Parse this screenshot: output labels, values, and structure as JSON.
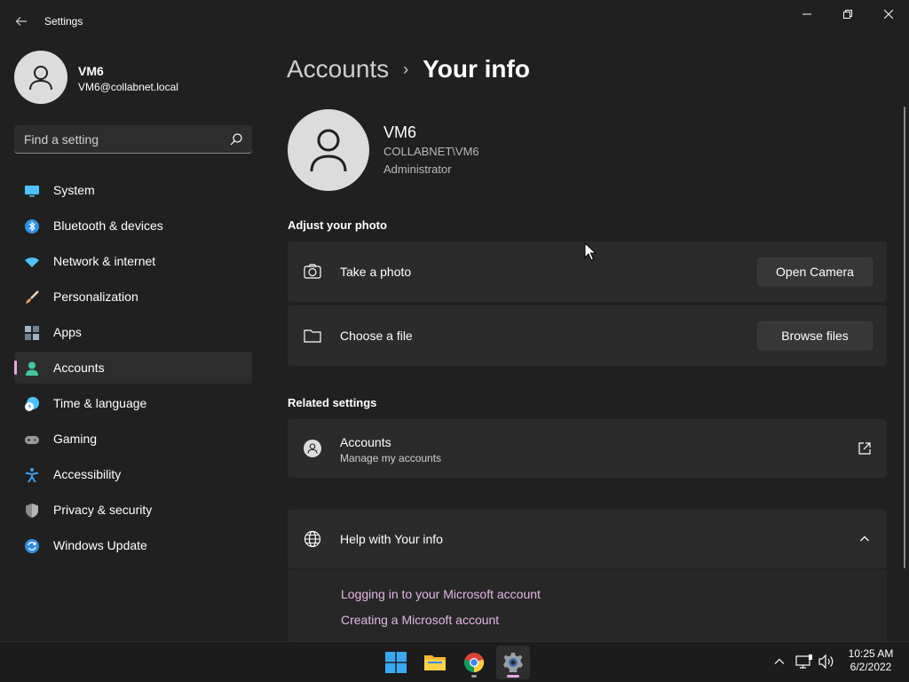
{
  "window": {
    "title": "Settings"
  },
  "profile": {
    "name": "VM6",
    "email": "VM6@collabnet.local"
  },
  "search": {
    "placeholder": "Find a setting"
  },
  "sidebar": {
    "items": [
      {
        "label": "System",
        "icon": "system-icon",
        "color": "#4cc2ff",
        "active": false
      },
      {
        "label": "Bluetooth & devices",
        "icon": "bluetooth-icon",
        "color": "#2f8fe6",
        "active": false
      },
      {
        "label": "Network & internet",
        "icon": "wifi-icon",
        "color": "#4cc2ff",
        "active": false
      },
      {
        "label": "Personalization",
        "icon": "brush-icon",
        "color": "#e89a5a",
        "active": false
      },
      {
        "label": "Apps",
        "icon": "apps-icon",
        "color": "#9fb2c8",
        "active": false
      },
      {
        "label": "Accounts",
        "icon": "person-icon",
        "color": "#3ec9a0",
        "active": true
      },
      {
        "label": "Time & language",
        "icon": "clock-globe-icon",
        "color": "#4cc2ff",
        "active": false
      },
      {
        "label": "Gaming",
        "icon": "gamepad-icon",
        "color": "#9a9a9a",
        "active": false
      },
      {
        "label": "Accessibility",
        "icon": "accessibility-icon",
        "color": "#3aa0f0",
        "active": false
      },
      {
        "label": "Privacy & security",
        "icon": "shield-icon",
        "color": "#8c8c8c",
        "active": false
      },
      {
        "label": "Windows Update",
        "icon": "update-icon",
        "color": "#2f8fe6",
        "active": false
      }
    ]
  },
  "breadcrumb": {
    "parent": "Accounts",
    "separator": "›",
    "current": "Your info"
  },
  "user": {
    "name": "VM6",
    "domain": "COLLABNET\\VM6",
    "role": "Administrator"
  },
  "adjust_photo": {
    "title": "Adjust your photo",
    "take_photo": {
      "label": "Take a photo",
      "button": "Open Camera"
    },
    "choose_file": {
      "label": "Choose a file",
      "button": "Browse files"
    }
  },
  "related": {
    "title": "Related settings",
    "accounts": {
      "label": "Accounts",
      "sublabel": "Manage my accounts"
    }
  },
  "help": {
    "title": "Help with Your info",
    "links": [
      "Logging in to your Microsoft account",
      "Creating a Microsoft account"
    ]
  },
  "taskbar": {
    "apps": [
      "start-icon",
      "file-explorer-icon",
      "chrome-icon",
      "settings-icon"
    ],
    "time": "10:25 AM",
    "date": "6/2/2022"
  },
  "colors": {
    "accent": "#e8a6e5",
    "background": "#202020",
    "card": "#2b2b2b"
  }
}
